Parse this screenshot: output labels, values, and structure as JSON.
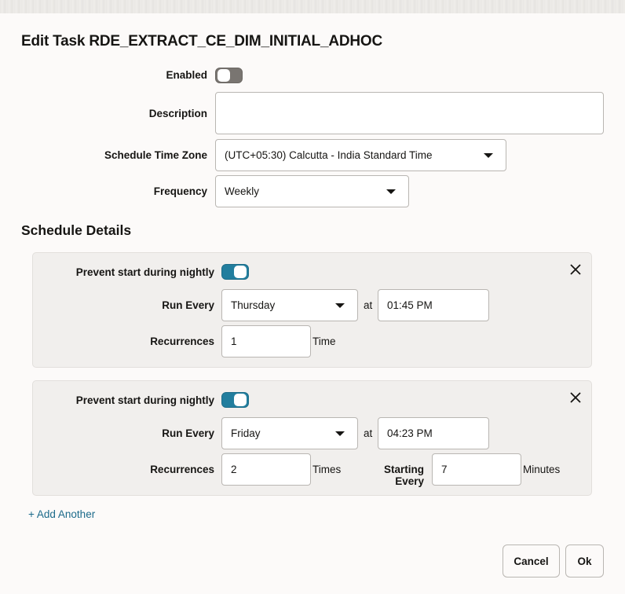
{
  "dialog": {
    "title": "Edit Task RDE_EXTRACT_CE_DIM_INITIAL_ADHOC"
  },
  "form": {
    "enabled": {
      "label": "Enabled",
      "value": false
    },
    "description": {
      "label": "Description",
      "value": ""
    },
    "time_zone": {
      "label": "Schedule Time Zone",
      "value": "(UTC+05:30) Calcutta - India Standard Time"
    },
    "frequency": {
      "label": "Frequency",
      "value": "Weekly"
    }
  },
  "schedule_details": {
    "title": "Schedule Details",
    "schedules": [
      {
        "prevent_label": "Prevent start during nightly",
        "prevent_value": true,
        "run_every_label": "Run Every",
        "run_every_value": "Thursday",
        "at_label": "at",
        "time_value": "01:45 PM",
        "recurrences_label": "Recurrences",
        "recurrences_value": "1",
        "recurrences_unit": "Time"
      },
      {
        "prevent_label": "Prevent start during nightly",
        "prevent_value": true,
        "run_every_label": "Run Every",
        "run_every_value": "Friday",
        "at_label": "at",
        "time_value": "04:23 PM",
        "recurrences_label": "Recurrences",
        "recurrences_value": "2",
        "recurrences_unit": "Times",
        "starting_every_label": "Starting Every",
        "starting_every_value": "7",
        "starting_every_unit": "Minutes"
      }
    ],
    "add_another_label": "+ Add Another"
  },
  "footer": {
    "cancel_label": "Cancel",
    "ok_label": "Ok"
  },
  "colors": {
    "accent": "#227e9e",
    "link": "#1b6a8a",
    "toggle_off": "#797571",
    "panel_bg": "#f1efed",
    "page_bg": "#fcfaf9"
  }
}
